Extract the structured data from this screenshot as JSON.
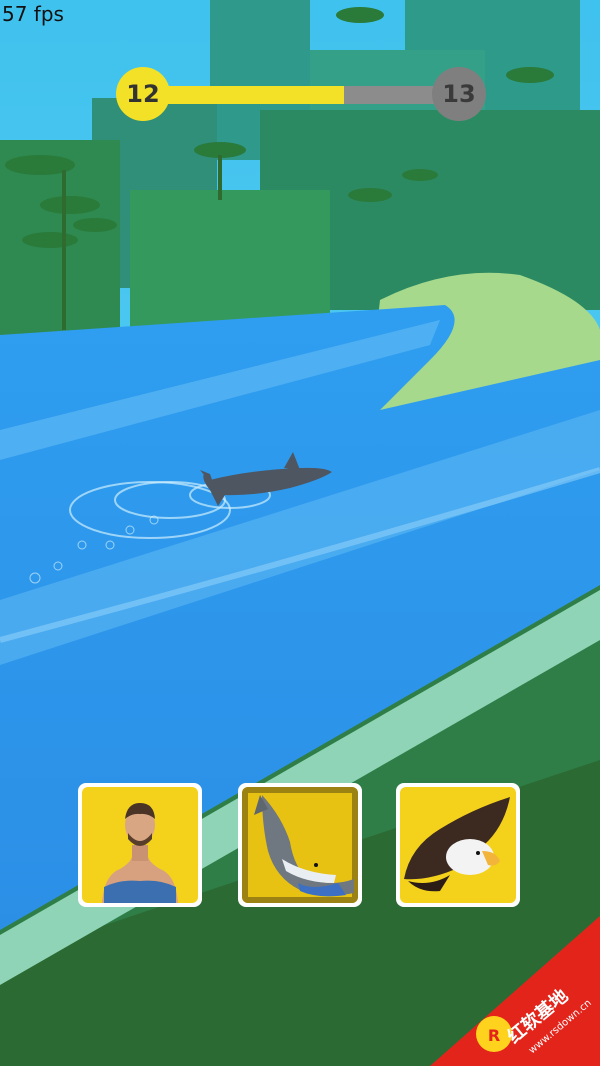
{
  "fps_counter": "57 fps",
  "level": {
    "current": "12",
    "next": "13",
    "progress": 0.64
  },
  "forms": [
    {
      "name": "human",
      "selected": false
    },
    {
      "name": "shark",
      "selected": true
    },
    {
      "name": "eagle",
      "selected": false
    }
  ],
  "watermark": {
    "brand": "红软基地",
    "url": "www.rsdown.cn"
  },
  "colors": {
    "progress_yellow": "#f2e126",
    "progress_gray": "#8c8c8c",
    "card_yellow": "#f4d21c",
    "water": "#3aa2ee",
    "jungle": "#3b8f58"
  }
}
